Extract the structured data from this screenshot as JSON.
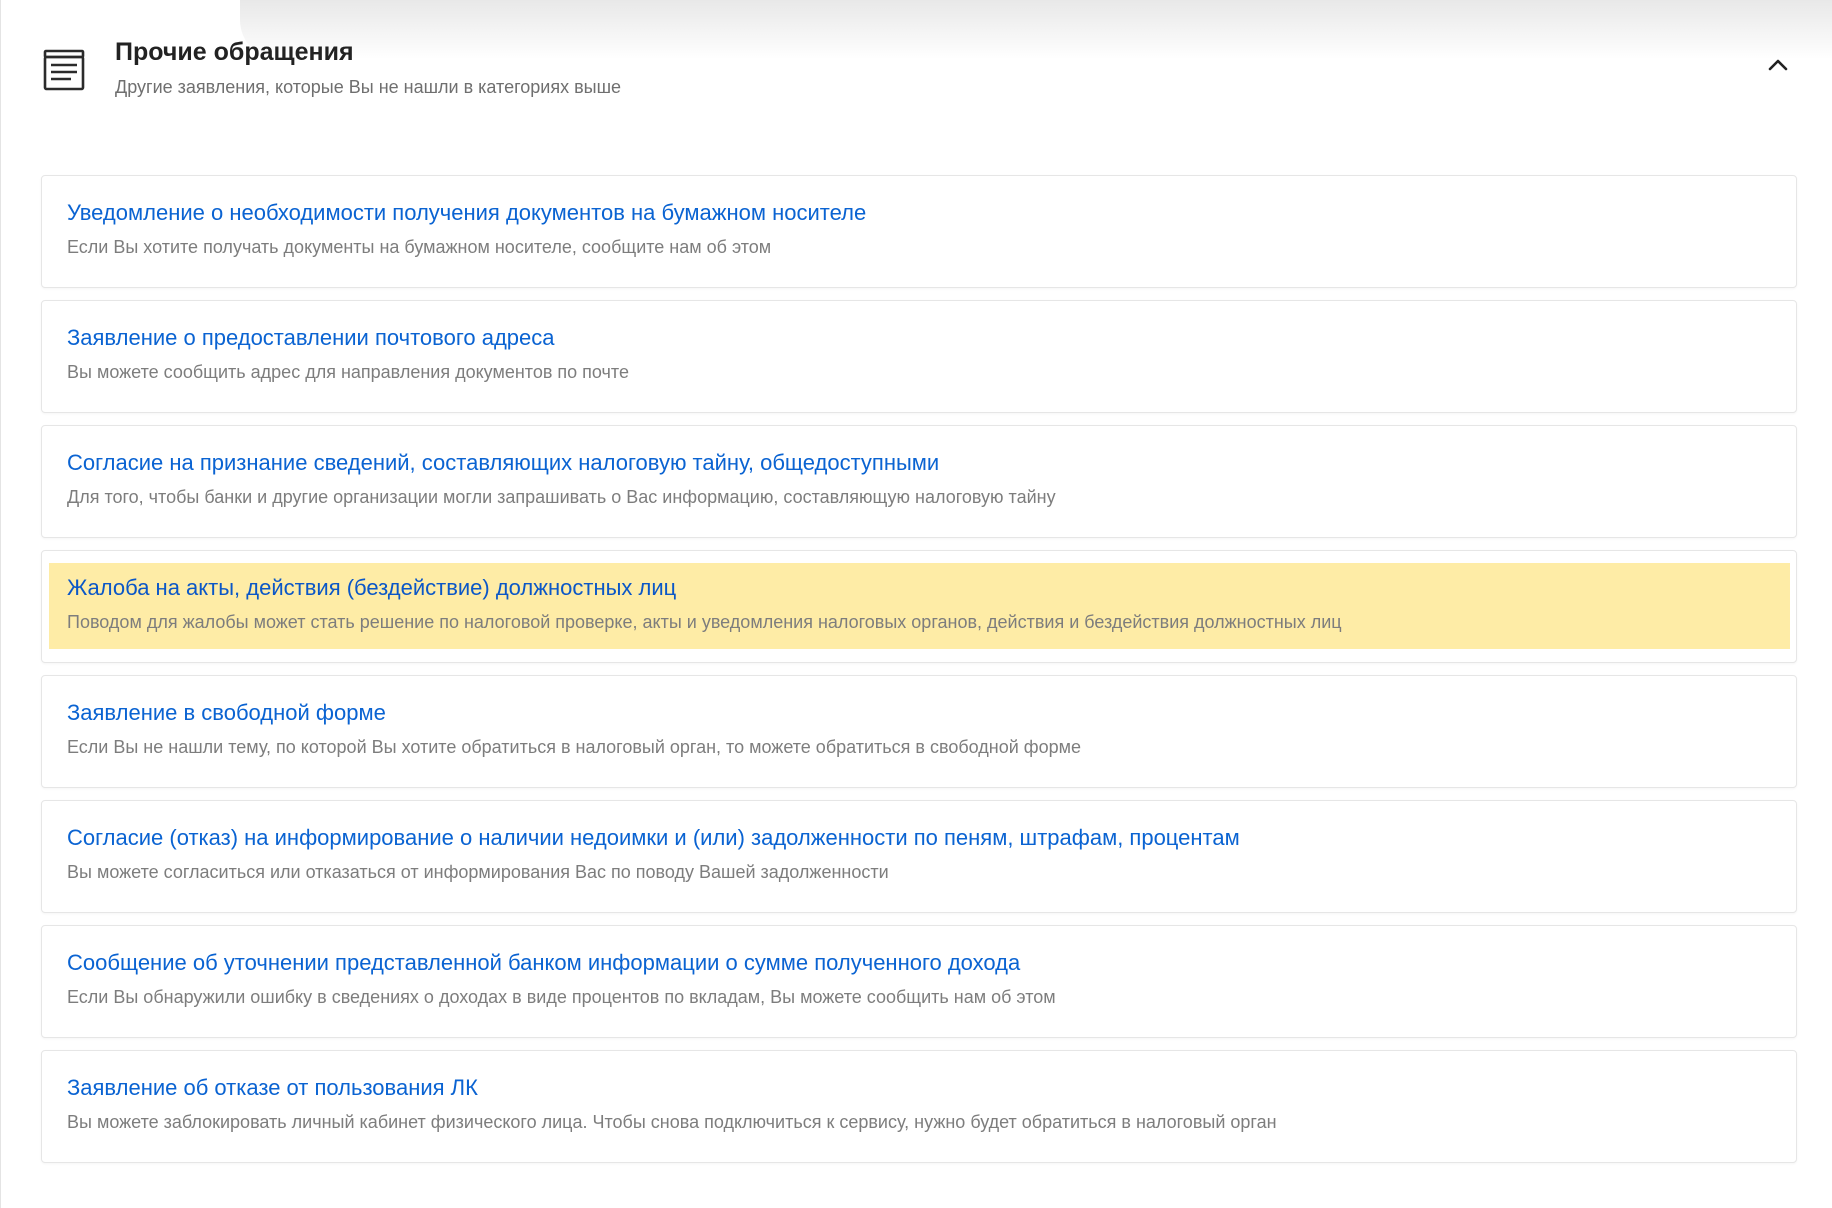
{
  "section": {
    "icon": "document-stack-icon",
    "title": "Прочие обращения",
    "subtitle": "Другие заявления, которые Вы не нашли в категориях выше",
    "collapse_icon": "chevron-up-icon",
    "expanded": true
  },
  "colors": {
    "link": "#0a63d2",
    "description": "#7d7d7d",
    "highlight": "#feeca6",
    "border": "#e6e6e6"
  },
  "items": [
    {
      "title": "Уведомление о необходимости получения документов на бумажном носителе",
      "description": "Если Вы хотите получать документы на бумажном носителе, сообщите нам об этом",
      "highlighted": false
    },
    {
      "title": "Заявление о предоставлении почтового адреса",
      "description": "Вы можете сообщить адрес для направления документов по почте",
      "highlighted": false
    },
    {
      "title": "Согласие на признание сведений, составляющих налоговую тайну, общедоступными",
      "description": "Для того, чтобы банки и другие организации могли запрашивать о Вас информацию, составляющую налоговую тайну",
      "highlighted": false
    },
    {
      "title": "Жалоба на акты, действия (бездействие) должностных лиц",
      "description": "Поводом для жалобы может стать решение по налоговой проверке, акты и уведомления налоговых органов, действия и бездействия должностных лиц",
      "highlighted": true
    },
    {
      "title": "Заявление в свободной форме",
      "description": "Если Вы не нашли тему, по которой Вы хотите обратиться в налоговый орган, то можете обратиться в свободной форме",
      "highlighted": false
    },
    {
      "title": "Согласие (отказ) на информирование о наличии недоимки и (или) задолженности по пеням, штрафам, процентам",
      "description": "Вы можете согласиться или отказаться от информирования Вас по поводу Вашей задолженности",
      "highlighted": false
    },
    {
      "title": "Сообщение об уточнении представленной банком информации о сумме полученного дохода",
      "description": "Если Вы обнаружили ошибку в сведениях о доходах в виде процентов по вкладам, Вы можете сообщить нам об этом",
      "highlighted": false
    },
    {
      "title": "Заявление об отказе от пользования ЛК",
      "description": "Вы можете заблокировать личный кабинет физического лица. Чтобы снова подключиться к сервису, нужно будет обратиться в налоговый орган",
      "highlighted": false
    }
  ]
}
